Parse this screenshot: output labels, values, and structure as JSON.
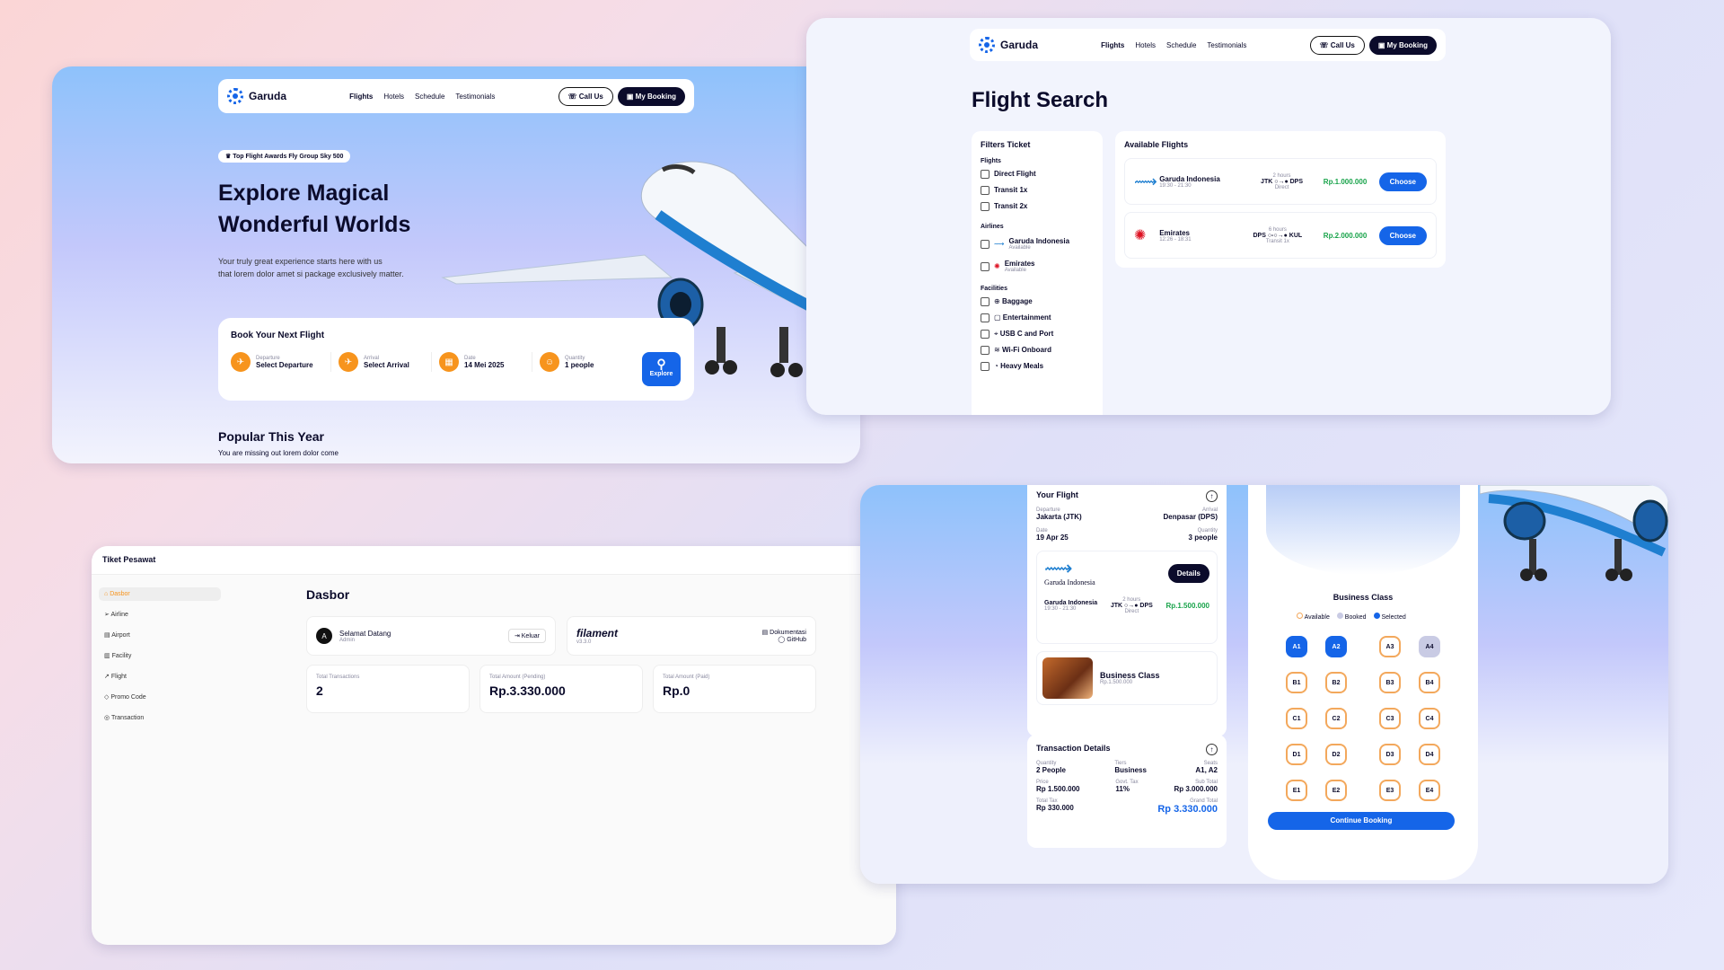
{
  "home": {
    "nav": {
      "logo": "Garuda",
      "links": [
        "Flights",
        "Hotels",
        "Schedule",
        "Testimonials"
      ],
      "call": "Call Us",
      "booking": "My Booking"
    },
    "badge": "Top Flight Awards Fly Group Sky 500",
    "title1": "Explore Magical",
    "title2": "Wonderful Worlds",
    "subtitle1": "Your truly great experience starts here with us",
    "subtitle2": "that lorem dolor amet si package exclusively matter.",
    "book": {
      "title": "Book Your Next Flight",
      "fields": [
        {
          "label": "Departure",
          "value": "Select Departure"
        },
        {
          "label": "Arrival",
          "value": "Select Arrival"
        },
        {
          "label": "Date",
          "value": "14 Mei 2025"
        },
        {
          "label": "Quantity",
          "value": "1 people"
        }
      ],
      "explore": "Explore"
    },
    "popular": "Popular This Year",
    "popular_sub": "You are missing out lorem dolor come"
  },
  "search": {
    "nav": {
      "logo": "Garuda",
      "links": [
        "Flights",
        "Hotels",
        "Schedule",
        "Testimonials"
      ],
      "call": "Call Us",
      "booking": "My Booking"
    },
    "title": "Flight Search",
    "filters_title": "Filters Ticket",
    "flights_label": "Flights",
    "flight_opts": [
      "Direct Flight",
      "Transit 1x",
      "Transit 2x"
    ],
    "airlines_label": "Airlines",
    "airlines": [
      {
        "name": "Garuda Indonesia",
        "status": "Available"
      },
      {
        "name": "Emirates",
        "status": "Available"
      }
    ],
    "facilities_label": "Facilities",
    "facilities": [
      "Baggage",
      "Entertainment",
      "USB C and Port",
      "Wi-Fi Onboard",
      "Heavy Meals"
    ],
    "available_title": "Available Flights",
    "results": [
      {
        "airline": "Garuda Indonesia",
        "time": "19:30 - 21:30",
        "duration": "2 hours",
        "route": "JTK ○→● DPS",
        "type": "Direct",
        "price": "Rp.1.000.000",
        "choose": "Choose"
      },
      {
        "airline": "Emirates",
        "time": "12:26 - 18:31",
        "duration": "6 hours",
        "route": "DPS ○-○→● KUL",
        "type": "Transit 1x",
        "price": "Rp.2.000.000",
        "choose": "Choose"
      }
    ]
  },
  "admin": {
    "app": "Tiket Pesawat",
    "menu": [
      "Dasbor",
      "Airline",
      "Airport",
      "Facility",
      "Flight",
      "Promo Code",
      "Transaction"
    ],
    "page_title": "Dasbor",
    "welcome": "Selamat Datang",
    "role": "Admin",
    "avatar": "A",
    "logout": "Keluar",
    "brand": "filament",
    "version": "v3.3.0",
    "docs": "Dokumentasi",
    "github": "GitHub",
    "stats": [
      {
        "label": "Total Transactions",
        "value": "2"
      },
      {
        "label": "Total Amount (Pending)",
        "value": "Rp.3.330.000"
      },
      {
        "label": "Total Amount (Paid)",
        "value": "Rp.0"
      }
    ]
  },
  "booking": {
    "your_flight": "Your Flight",
    "departure_label": "Departure",
    "departure": "Jakarta (JTK)",
    "arrival_label": "Arrival",
    "arrival": "Denpasar (DPS)",
    "date_label": "Date",
    "date": "19 Apr 25",
    "qty_label": "Quantity",
    "qty": "3 people",
    "airline": "Garuda Indonesia",
    "details": "Details",
    "flight_time": "19:30 - 21:30",
    "duration": "2 hours",
    "route": "JTK ○→● DPS",
    "type": "Direct",
    "price": "Rp.1.500.000",
    "class_title": "Business Class",
    "class_price": "Rp.1.500.000",
    "tx_title": "Transaction Details",
    "qty2_label": "Quantity",
    "qty2": "2 People",
    "tiers_label": "Tiers",
    "tiers": "Business",
    "seats_label": "Seats",
    "seats": "A1, A2",
    "price_label": "Price",
    "price2": "Rp 1.500.000",
    "tax_label": "Govt. Tax",
    "tax": "11%",
    "sub_label": "Sub Total",
    "sub": "Rp 3.000.000",
    "totaltax_label": "Total Tax",
    "totaltax": "Rp 330.000",
    "grand_label": "Grand Total",
    "grand": "Rp 3.330.000",
    "seatmap": {
      "title": "Business Class",
      "legend": [
        "Available",
        "Booked",
        "Selected"
      ],
      "continue": "Continue Booking",
      "rows": [
        [
          "A1",
          "A2",
          "A3",
          "A4"
        ],
        [
          "B1",
          "B2",
          "B3",
          "B4"
        ],
        [
          "C1",
          "C2",
          "C3",
          "C4"
        ],
        [
          "D1",
          "D2",
          "D3",
          "D4"
        ],
        [
          "E1",
          "E2",
          "E3",
          "E4"
        ]
      ],
      "selected": [
        "A1",
        "A2"
      ],
      "booked": [
        "A4"
      ]
    }
  },
  "colors": {
    "primary": "#1565e8",
    "dark": "#0b0b2b",
    "orange": "#f7941d",
    "green": "#18a34a"
  }
}
